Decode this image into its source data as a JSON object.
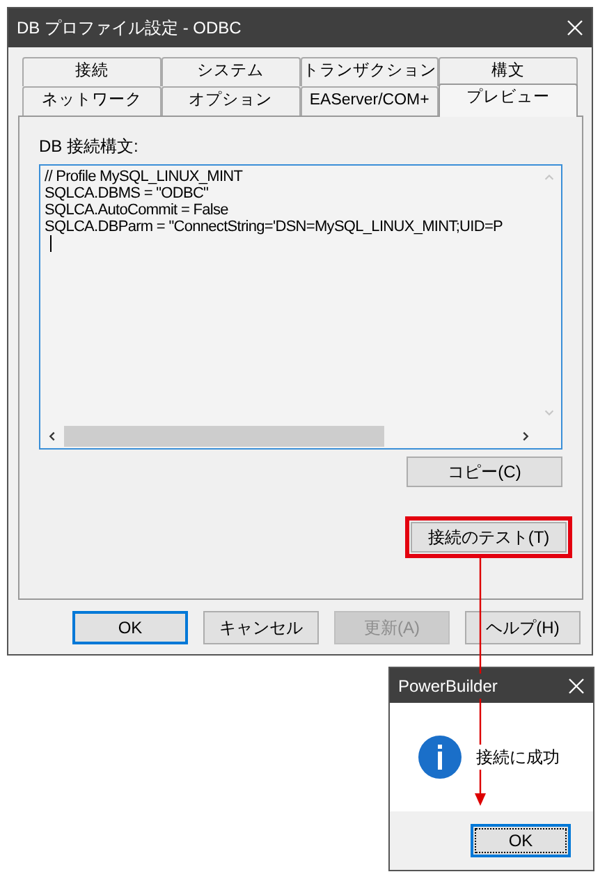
{
  "dialog": {
    "title": "DB プロファイル設定 - ODBC",
    "tab_rows": [
      [
        {
          "label": "接続",
          "selected": false
        },
        {
          "label": "システム",
          "selected": false
        },
        {
          "label": "トランザクション",
          "selected": false
        },
        {
          "label": "構文",
          "selected": false
        }
      ],
      [
        {
          "label": "ネットワーク",
          "selected": false
        },
        {
          "label": "オプション",
          "selected": false
        },
        {
          "label": "EAServer/COM+",
          "selected": false
        },
        {
          "label": "プレビュー",
          "selected": true
        }
      ]
    ],
    "syntax_label": "DB 接続構文:",
    "code_lines": [
      "// Profile MySQL_LINUX_MINT",
      "SQLCA.DBMS = \"ODBC\"",
      "SQLCA.AutoCommit = False",
      "SQLCA.DBParm = \"ConnectString='DSN=MySQL_LINUX_MINT;UID=P"
    ],
    "copy_button": "コピー(C)",
    "test_button": {
      "label": "接続のテスト(T)",
      "highlighted": true
    },
    "buttons": [
      {
        "label": "OK",
        "default": true,
        "disabled": false
      },
      {
        "label": "キャンセル",
        "default": false,
        "disabled": false
      },
      {
        "label": "更新(A)",
        "default": false,
        "disabled": true
      },
      {
        "label": "ヘルプ(H)",
        "default": false,
        "disabled": false
      }
    ]
  },
  "message_box": {
    "title": "PowerBuilder",
    "message": "接続に成功",
    "button": "OK"
  }
}
